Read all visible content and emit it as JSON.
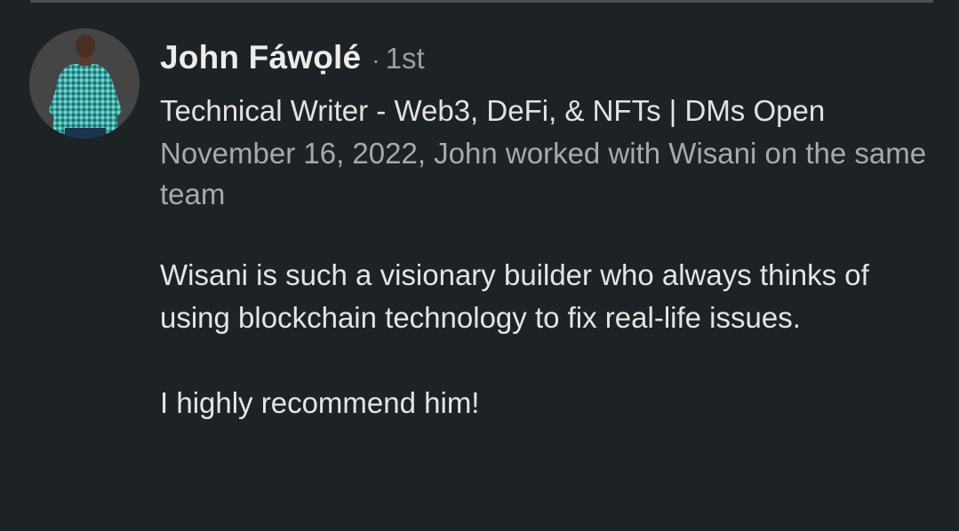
{
  "recommendation": {
    "author": {
      "name": "John Fáwọlé",
      "separator": "·",
      "connection_degree": "1st",
      "headline": "Technical Writer - Web3, DeFi, & NFTs | DMs Open",
      "avatar_icon": "profile-photo"
    },
    "meta": "November 16, 2022, John worked with Wisani on the same team",
    "body": "Wisani is such a visionary builder who always thinks of using blockchain technology to fix real-life issues.",
    "closing": "I highly recommend him!"
  },
  "colors": {
    "background": "#1d2226",
    "name_text": "#ececec",
    "secondary_text": "#a6a9ad"
  }
}
